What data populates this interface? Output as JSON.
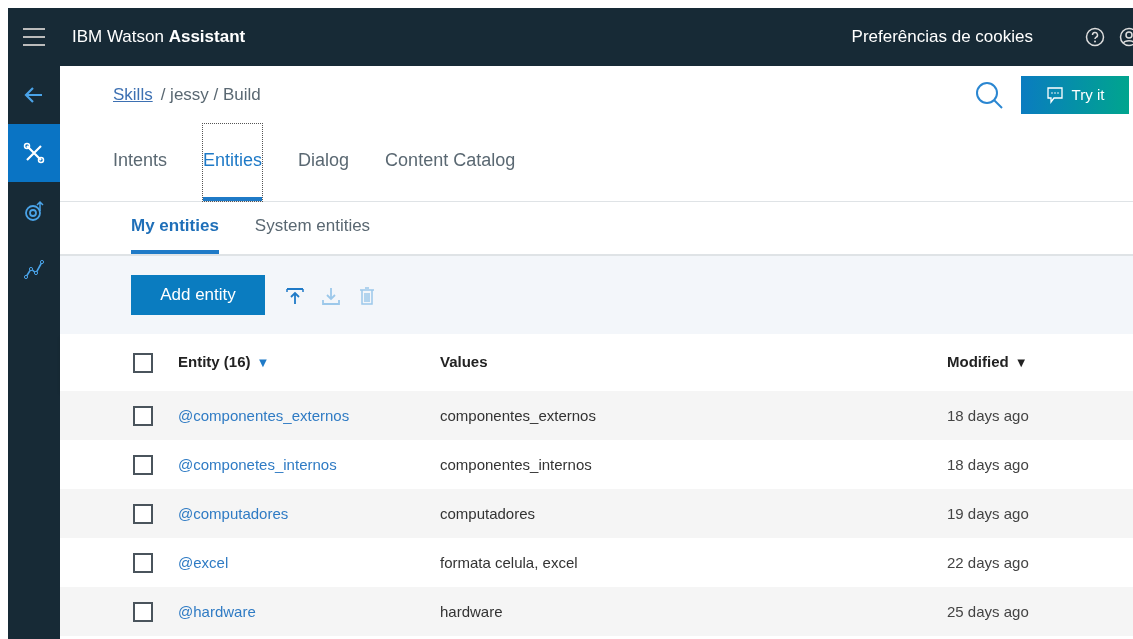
{
  "header": {
    "title_plain": "IBM Watson ",
    "title_bold": "Assistant",
    "cookies": "Preferências de cookies"
  },
  "sidebar": {
    "items": [
      {
        "kind": "back",
        "selected": false
      },
      {
        "kind": "tools",
        "selected": true
      },
      {
        "kind": "target",
        "selected": false
      },
      {
        "kind": "analytics",
        "selected": false
      }
    ]
  },
  "breadcrumb": {
    "link": "Skills",
    "rest": "/ jessy / Build"
  },
  "try_button": "Try it",
  "tabs": [
    {
      "label": "Intents",
      "selected": false
    },
    {
      "label": "Entities",
      "selected": true
    },
    {
      "label": "Dialog",
      "selected": false
    },
    {
      "label": "Content Catalog",
      "selected": false
    }
  ],
  "subtabs": [
    {
      "label": "My entities",
      "selected": true
    },
    {
      "label": "System entities",
      "selected": false
    }
  ],
  "toolbar": {
    "add_button": "Add entity",
    "actions": [
      {
        "kind": "upload",
        "disabled": false
      },
      {
        "kind": "download",
        "disabled": true
      },
      {
        "kind": "delete",
        "disabled": true
      }
    ]
  },
  "table": {
    "select_all_checked": false,
    "columns": [
      {
        "label": "Entity (16)",
        "sort_arrow": "▼",
        "active": true
      },
      {
        "label": "Values"
      },
      {
        "label": "Modified",
        "sort_arrow": "▼",
        "active": false
      }
    ],
    "rows": [
      {
        "checked": false,
        "entity": "@componentes_externos",
        "values": "componentes_externos",
        "modified": "18 days ago"
      },
      {
        "checked": false,
        "entity": "@componetes_internos",
        "values": "componentes_internos",
        "modified": "18 days ago"
      },
      {
        "checked": false,
        "entity": "@computadores",
        "values": "computadores",
        "modified": "19 days ago"
      },
      {
        "checked": false,
        "entity": "@excel",
        "values": "formata celula, excel",
        "modified": "22 days ago"
      },
      {
        "checked": false,
        "entity": "@hardware",
        "values": "hardware",
        "modified": "25 days ago"
      }
    ]
  }
}
